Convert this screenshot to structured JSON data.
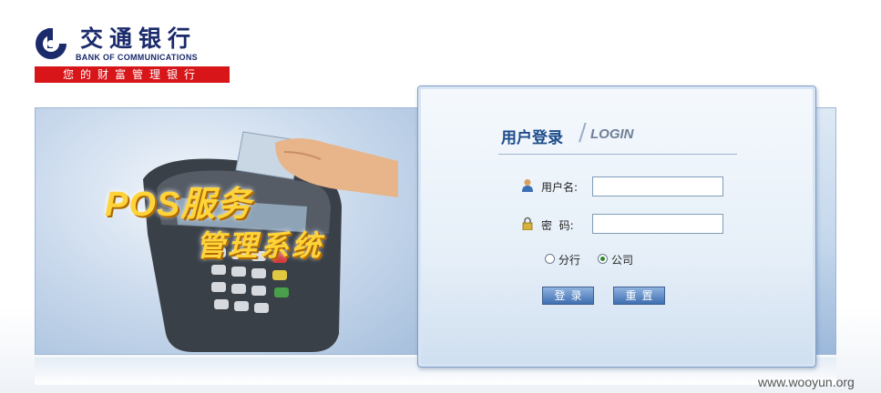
{
  "header": {
    "bank_name_cn": "交通银行",
    "bank_name_en": "BANK OF COMMUNICATIONS",
    "slogan": "您的财富管理银行",
    "logo_icon": "bocom-logo-icon"
  },
  "banner": {
    "title_line1": "POS服务",
    "title_line2": "管理系统",
    "illustration": "pos-terminal-card-swipe-image"
  },
  "login": {
    "title": "用户登录",
    "title_separator": "/",
    "title_en": "LOGIN",
    "username_label": "用户名:",
    "username_value": "",
    "username_icon": "user-icon",
    "password_label": "密  码:",
    "password_value": "",
    "password_icon": "lock-icon",
    "radio_options": [
      {
        "label": "分行",
        "checked": false
      },
      {
        "label": "公司",
        "checked": true
      }
    ],
    "login_button": "登录",
    "reset_button": "重置"
  },
  "watermark": "www.wooyun.org",
  "colors": {
    "brand_navy": "#1a2a6b",
    "brand_red": "#d8161a",
    "title_blue": "#1d4c8a",
    "banner_text_gold": "#ffd43a",
    "button_blue": "#3f6fb1"
  }
}
